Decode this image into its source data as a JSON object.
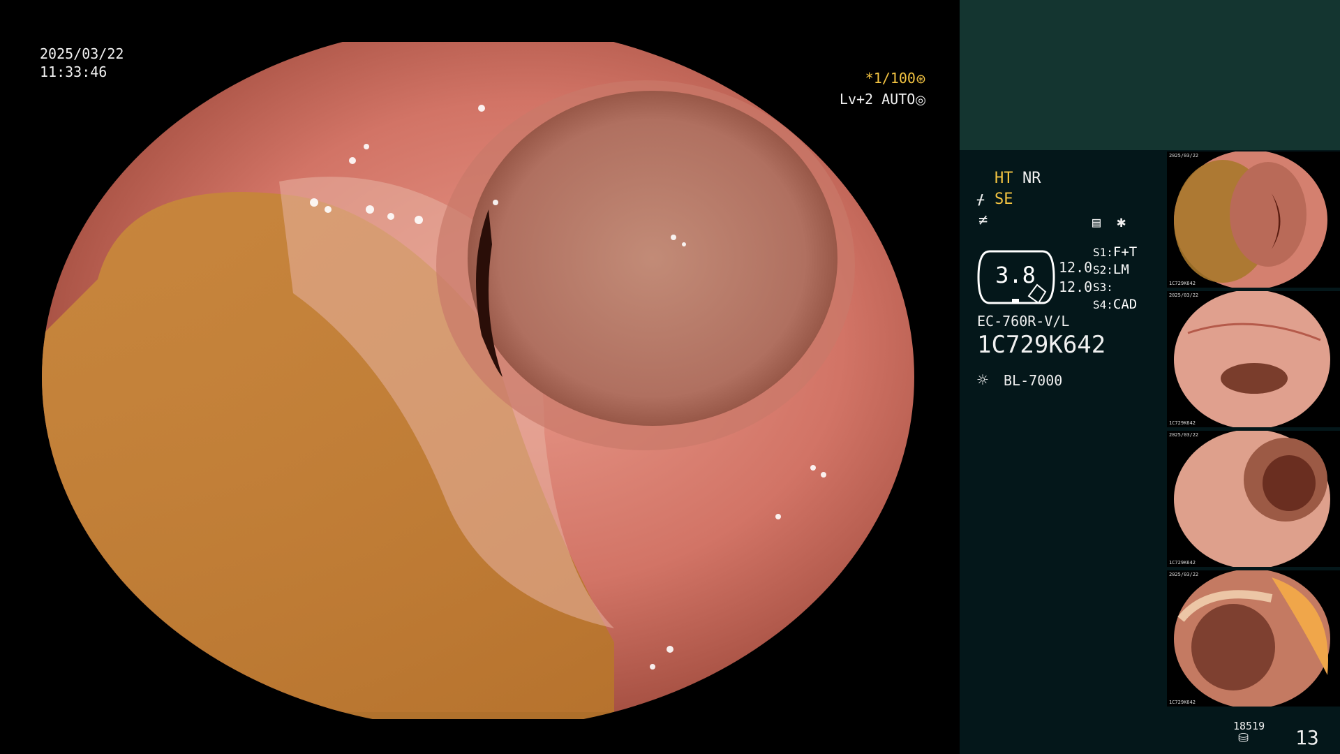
{
  "datetime": {
    "date": "2025/03/22",
    "time": "11:33:46"
  },
  "shutter": {
    "speed": "*1/100",
    "level": "Lv+2 AUTO"
  },
  "enhancement": {
    "ht": "HT",
    "nr": "NR",
    "se": "SE"
  },
  "gauge": {
    "value": "3.8",
    "val1": "12.0",
    "val2": "12.0"
  },
  "scope_buttons": [
    {
      "key": "S1:",
      "value": "F+T"
    },
    {
      "key": "S2:",
      "value": "LM"
    },
    {
      "key": "S3:",
      "value": ""
    },
    {
      "key": "S4:",
      "value": "CAD"
    }
  ],
  "scope": {
    "model": "EC-760R-V/L",
    "serial": "1C729K642"
  },
  "light_source": {
    "model": "BL-7000"
  },
  "footer": {
    "storage_count": "18519",
    "capture_count": "13"
  },
  "thumbnails": [
    {
      "date": "2025/03/22",
      "serial": "1C729K642"
    },
    {
      "date": "2025/03/22",
      "serial": "1C729K642"
    },
    {
      "date": "2025/03/22",
      "serial": "1C729K642"
    },
    {
      "date": "2025/03/22",
      "serial": "1C729K642"
    }
  ],
  "colors": {
    "panel_teal": "#143530",
    "panel_dark": "#04171a",
    "accent_yellow": "#f5c542"
  }
}
